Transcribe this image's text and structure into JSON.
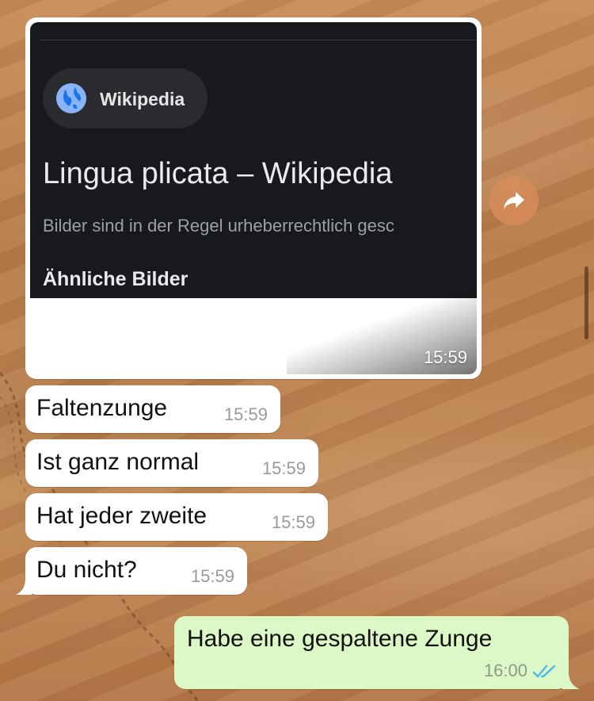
{
  "media_message": {
    "source_name": "Wikipedia",
    "result_title": "Lingua plicata – Wikipedia",
    "result_snippet": "Bilder sind in der Regel urheberrechtlich gesc",
    "section_label": "Ähnliche Bilder",
    "time": "15:59"
  },
  "incoming_messages": [
    {
      "text": "Faltenzunge",
      "time": "15:59"
    },
    {
      "text": "Ist ganz normal",
      "time": "15:59"
    },
    {
      "text": "Hat jeder zweite",
      "time": "15:59"
    },
    {
      "text": "Du nicht?",
      "time": "15:59"
    }
  ],
  "outgoing_message": {
    "text": "Habe eine gespaltene Zunge",
    "time": "16:00",
    "status": "read"
  },
  "colors": {
    "incoming_bubble": "#ffffff",
    "outgoing_bubble": "#dcf8c6",
    "read_ticks": "#4fb6ec",
    "forward_button": "#d78c5a"
  },
  "icons": {
    "source": "globe-icon",
    "forward": "forward-arrow-icon",
    "status": "double-check-icon"
  }
}
